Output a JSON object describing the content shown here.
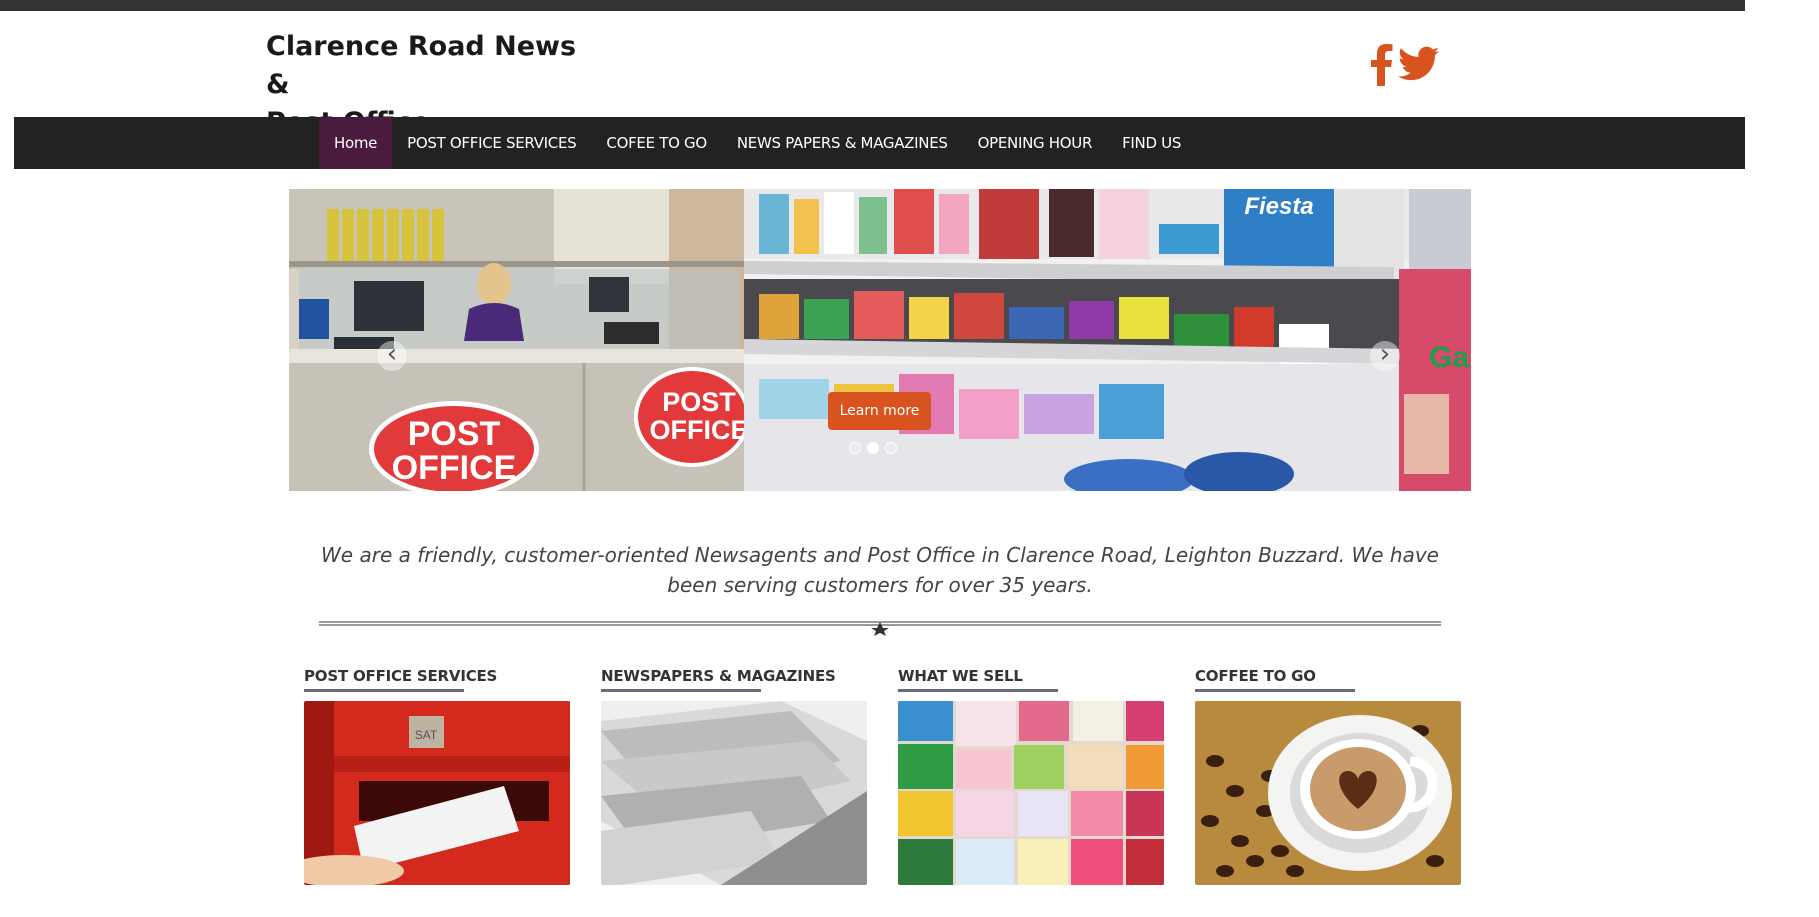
{
  "site": {
    "title_line1": "Clarence Road News &",
    "title_line2": "Post Office"
  },
  "social": {
    "facebook_icon": "facebook-f-icon",
    "twitter_icon": "twitter-bird-icon",
    "color": "#d9531e"
  },
  "nav": {
    "items": [
      {
        "label": "Home",
        "active": true
      },
      {
        "label": "POST OFFICE SERVICES"
      },
      {
        "label": "COFEE TO GO"
      },
      {
        "label": "NEWS PAPERS & MAGAZINES"
      },
      {
        "label": "OPENING HOUR"
      },
      {
        "label": "FIND US"
      }
    ],
    "active_color": "#4a1b3c",
    "bar_color": "#222222"
  },
  "slider": {
    "button_label": "Learn more",
    "button_color": "#d9531e",
    "prev_icon": "chevron-left-icon",
    "next_icon": "chevron-right-icon",
    "prev_glyph": "‹",
    "next_glyph": "›",
    "slide_count": 3,
    "active_slide": 1,
    "image_description": "post-office-counter-and-shop-shelves"
  },
  "intro": {
    "text": "We are a friendly, customer-oriented Newsagents and Post Office in Clarence Road, Leighton Buzzard. We have been serving customers for over 35 years."
  },
  "features": [
    {
      "title": "POST OFFICE SERVICES",
      "image": "red-postbox"
    },
    {
      "title": "NEWSPAPERS & MAGAZINES",
      "image": "folded-newspapers"
    },
    {
      "title": "WHAT WE SELL",
      "image": "greeting-cards"
    },
    {
      "title": "COFFEE TO GO",
      "image": "coffee-cup-beans"
    }
  ]
}
